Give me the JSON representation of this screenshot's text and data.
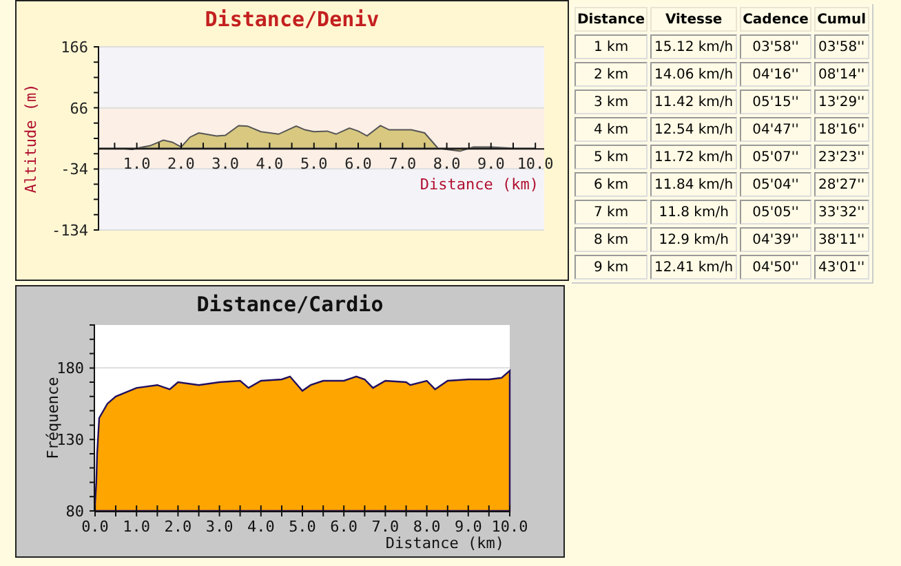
{
  "charts": [
    {
      "chart_data": {
        "type": "area",
        "title": "Distance/Deniv",
        "xlabel": "Distance (km)",
        "ylabel": "Altitude (m)",
        "xlim": [
          0.15,
          10.2
        ],
        "ylim": [
          -134,
          166
        ],
        "x": [
          0.15,
          0.6,
          0.9,
          1.0,
          1.3,
          1.6,
          1.8,
          2.0,
          2.2,
          2.4,
          2.8,
          3.0,
          3.3,
          3.5,
          3.8,
          4.2,
          4.6,
          4.8,
          5.0,
          5.3,
          5.5,
          5.8,
          6.0,
          6.2,
          6.5,
          6.7,
          7.0,
          7.2,
          7.5,
          7.8,
          8.0,
          8.3,
          8.6,
          9.0,
          9.5,
          10.0
        ],
        "series": [
          {
            "color": "#d8c880",
            "values": [
              0,
              0,
              -2,
              0,
              4,
              13,
              10,
              2,
              18,
              25,
              20,
              21,
              37,
              36,
              27,
              23,
              36,
              30,
              27,
              28,
              23,
              33,
              28,
              20,
              37,
              30,
              30,
              30,
              25,
              0,
              -2,
              -5,
              2,
              2,
              0,
              0
            ]
          }
        ],
        "xticks": [
          {
            "value": 1,
            "label": "1.0"
          },
          {
            "value": 2,
            "label": "2.0"
          },
          {
            "value": 3,
            "label": "3.0"
          },
          {
            "value": 4,
            "label": "4.0"
          },
          {
            "value": 5,
            "label": "5.0"
          },
          {
            "value": 6,
            "label": "6.0"
          },
          {
            "value": 7,
            "label": "7.0"
          },
          {
            "value": 8,
            "label": "8.0"
          },
          {
            "value": 9,
            "label": "9.0"
          },
          {
            "value": 10,
            "label": "10.0"
          }
        ],
        "yticks": [
          166,
          66,
          -34,
          -134
        ]
      }
    },
    {
      "chart_data": {
        "type": "area",
        "title": "Distance/Cardio",
        "xlabel": "Distance (km)",
        "ylabel": "Fréquence",
        "xlim": [
          0,
          10
        ],
        "ylim": [
          80,
          210
        ],
        "x": [
          0,
          0.03,
          0.05,
          0.1,
          0.3,
          0.5,
          1.0,
          1.5,
          1.8,
          2.0,
          2.5,
          3.0,
          3.5,
          3.7,
          4.0,
          4.5,
          4.7,
          5.0,
          5.2,
          5.5,
          6.0,
          6.3,
          6.5,
          6.7,
          7.0,
          7.5,
          7.6,
          8.0,
          8.2,
          8.5,
          9.0,
          9.5,
          9.8,
          10.0
        ],
        "series": [
          {
            "color": "#ffa500",
            "values": [
              85,
              100,
              120,
              145,
              155,
              160,
              166,
              168,
              165,
              170,
              168,
              170,
              171,
              166,
              171,
              172,
              174,
              164,
              168,
              171,
              171,
              174,
              172,
              166,
              171,
              170,
              168,
              171,
              165,
              171,
              172,
              172,
              173,
              178
            ]
          }
        ],
        "xticks": [
          {
            "value": 0,
            "label": "0.0"
          },
          {
            "value": 1,
            "label": "1.0"
          },
          {
            "value": 2,
            "label": "2.0"
          },
          {
            "value": 3,
            "label": "3.0"
          },
          {
            "value": 4,
            "label": "4.0"
          },
          {
            "value": 5,
            "label": "5.0"
          },
          {
            "value": 6,
            "label": "6.0"
          },
          {
            "value": 7,
            "label": "7.0"
          },
          {
            "value": 8,
            "label": "8.0"
          },
          {
            "value": 9,
            "label": "9.0"
          },
          {
            "value": 10,
            "label": "10.0"
          }
        ],
        "yticks": [
          80,
          130,
          180
        ]
      }
    }
  ],
  "table": {
    "columns": [
      "Distance",
      "Vitesse",
      "Cadence",
      "Cumul"
    ],
    "rows": [
      [
        "1 km",
        "15.12 km/h",
        "03'58''",
        "03'58''"
      ],
      [
        "2 km",
        "14.06 km/h",
        "04'16''",
        "08'14''"
      ],
      [
        "3 km",
        "11.42 km/h",
        "05'15''",
        "13'29''"
      ],
      [
        "4 km",
        "12.54 km/h",
        "04'47''",
        "18'16''"
      ],
      [
        "5 km",
        "11.72 km/h",
        "05'07''",
        "23'23''"
      ],
      [
        "6 km",
        "11.84 km/h",
        "05'04''",
        "28'27''"
      ],
      [
        "7 km",
        "11.8 km/h",
        "05'05''",
        "33'32''"
      ],
      [
        "8 km",
        "12.9 km/h",
        "04'39''",
        "38'11''"
      ],
      [
        "9 km",
        "12.41 km/h",
        "04'50''",
        "43'01''"
      ]
    ]
  }
}
